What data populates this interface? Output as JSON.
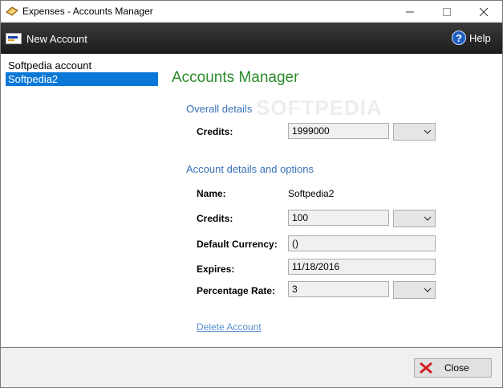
{
  "window": {
    "title": "Expenses - Accounts Manager"
  },
  "toolbar": {
    "new_account_label": "New Account",
    "help_label": "Help"
  },
  "sidebar": {
    "items": [
      {
        "label": "Softpedia account"
      },
      {
        "label": "Softpedia2"
      }
    ]
  },
  "main": {
    "title": "Accounts Manager",
    "watermark": "SOFTPEDIA",
    "overall": {
      "heading": "Overall details",
      "credits_label": "Credits:",
      "credits_value": "1999000"
    },
    "account": {
      "heading": "Account details and options",
      "name_label": "Name:",
      "name_value": "Softpedia2",
      "credits_label": "Credits:",
      "credits_value": "100",
      "currency_label": "Default Currency:",
      "currency_value": "()",
      "expires_label": "Expires:",
      "expires_value": "11/18/2016",
      "rate_label": "Percentage Rate:",
      "rate_value": "3"
    },
    "delete_link": "Delete Account"
  },
  "footer": {
    "close_label": "Close"
  },
  "colors": {
    "accent": "#0a78d7",
    "title_green": "#2a8a2a",
    "section_blue": "#3a72b8"
  }
}
